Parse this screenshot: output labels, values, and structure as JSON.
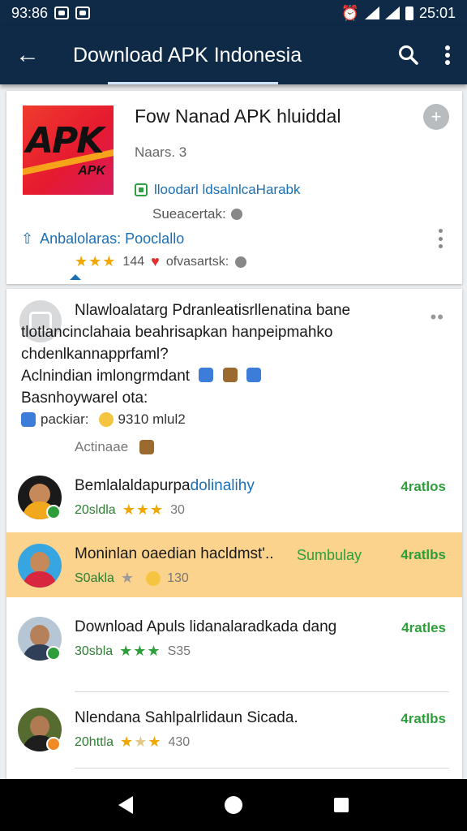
{
  "status_bar": {
    "time_left": "93:86",
    "time_right": "25:01"
  },
  "app_bar": {
    "title": "Download APK Indonesia"
  },
  "app_card": {
    "logo_main": "APK",
    "logo_sub": "APK",
    "title": "Fow Nanad APK hluiddal",
    "version": "Naars. 3",
    "verified": "lloodarl ldsalnlcaHarabk",
    "subtitle": "Sueacertak:",
    "link": "Anbalolaras: Pooclallo",
    "rating_count": "144",
    "rating_extra": "ofvasartsk:"
  },
  "post": {
    "line1": "Nlawloalatarg Pdranleatisrllenatina bane",
    "line2": "tlotlancinclahaia beahrisapkan hanpeipmahko",
    "line3": "chdenlkannapprfaml?",
    "line4": "Aclnindian imlongrmdant",
    "line5": "Basnhoywarel ota:",
    "meta_label": "packiar:",
    "meta_value": "9310 mlul2",
    "actions": "Actinaae"
  },
  "items": [
    {
      "name": "Bemlalaldapurpa",
      "name_hl": "dolinalihy",
      "meta": "20sldla",
      "count": "30",
      "status": "4ratlos",
      "tag": ""
    },
    {
      "name": "Moninlan oaedian hacldmst'..",
      "name_hl": "",
      "meta": "S0akla",
      "count": "130",
      "status": "4ratlbs",
      "tag": "Sumbulay"
    },
    {
      "name": "Download Apuls lidanalaradkada dang",
      "name_hl": "",
      "meta": "30sbla",
      "count": "S35",
      "status": "4ratles",
      "tag": ""
    },
    {
      "name": "Nlendana Sahlpalrlidaun Sicada.",
      "name_hl": "",
      "meta": "20httla",
      "count": "430",
      "status": "4ratlbs",
      "tag": ""
    }
  ],
  "colors": {
    "appbar": "#0e2a47",
    "accent_green": "#2e9e3a",
    "link_blue": "#1b6fb5",
    "selected_row": "#fbd38d"
  },
  "icons": [
    "back-arrow-icon",
    "search-icon",
    "more-vert-icon",
    "share-icon",
    "check-icon",
    "heart-icon",
    "star-icon"
  ]
}
